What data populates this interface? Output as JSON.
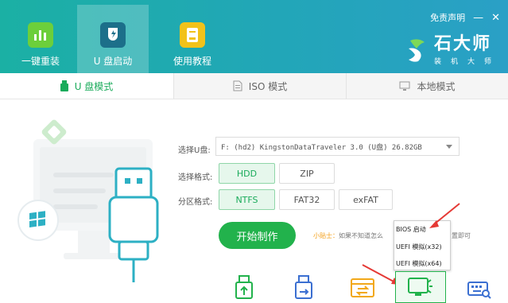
{
  "topbar": {
    "tabs": [
      {
        "label": "一键重装"
      },
      {
        "label": "U 盘启动"
      },
      {
        "label": "使用教程"
      }
    ],
    "disclaimer": "免责声明",
    "minimize": "—",
    "close": "✕",
    "brand": {
      "name": "石大师",
      "sub": "装机大师"
    }
  },
  "subtabs": [
    {
      "label": "U 盘模式",
      "active": true
    },
    {
      "label": "ISO 模式"
    },
    {
      "label": "本地模式"
    }
  ],
  "form": {
    "usb_label": "选择U盘:",
    "usb_value": "F: (hd2) KingstonDataTraveler 3.0 (U盘) 26.82GB",
    "boot_label": "选择格式:",
    "boot_options": [
      "HDD",
      "ZIP"
    ],
    "boot_selected": "HDD",
    "part_label": "分区格式:",
    "part_options": [
      "NTFS",
      "FAT32",
      "exFAT"
    ],
    "part_selected": "NTFS",
    "start_button": "开始制作",
    "tip_head": "小贴士：",
    "tip_text": "如果不知道怎么",
    "tip_tail": "置即可"
  },
  "boot_menu": {
    "items": [
      "BIOS 启动",
      "UEFI 模拟(x32)",
      "UEFI 模拟(x64)"
    ]
  },
  "colors": {
    "accent_green": "#22b24c",
    "topbar_teal": "#1bb0a4",
    "arrow_red": "#e53935"
  }
}
